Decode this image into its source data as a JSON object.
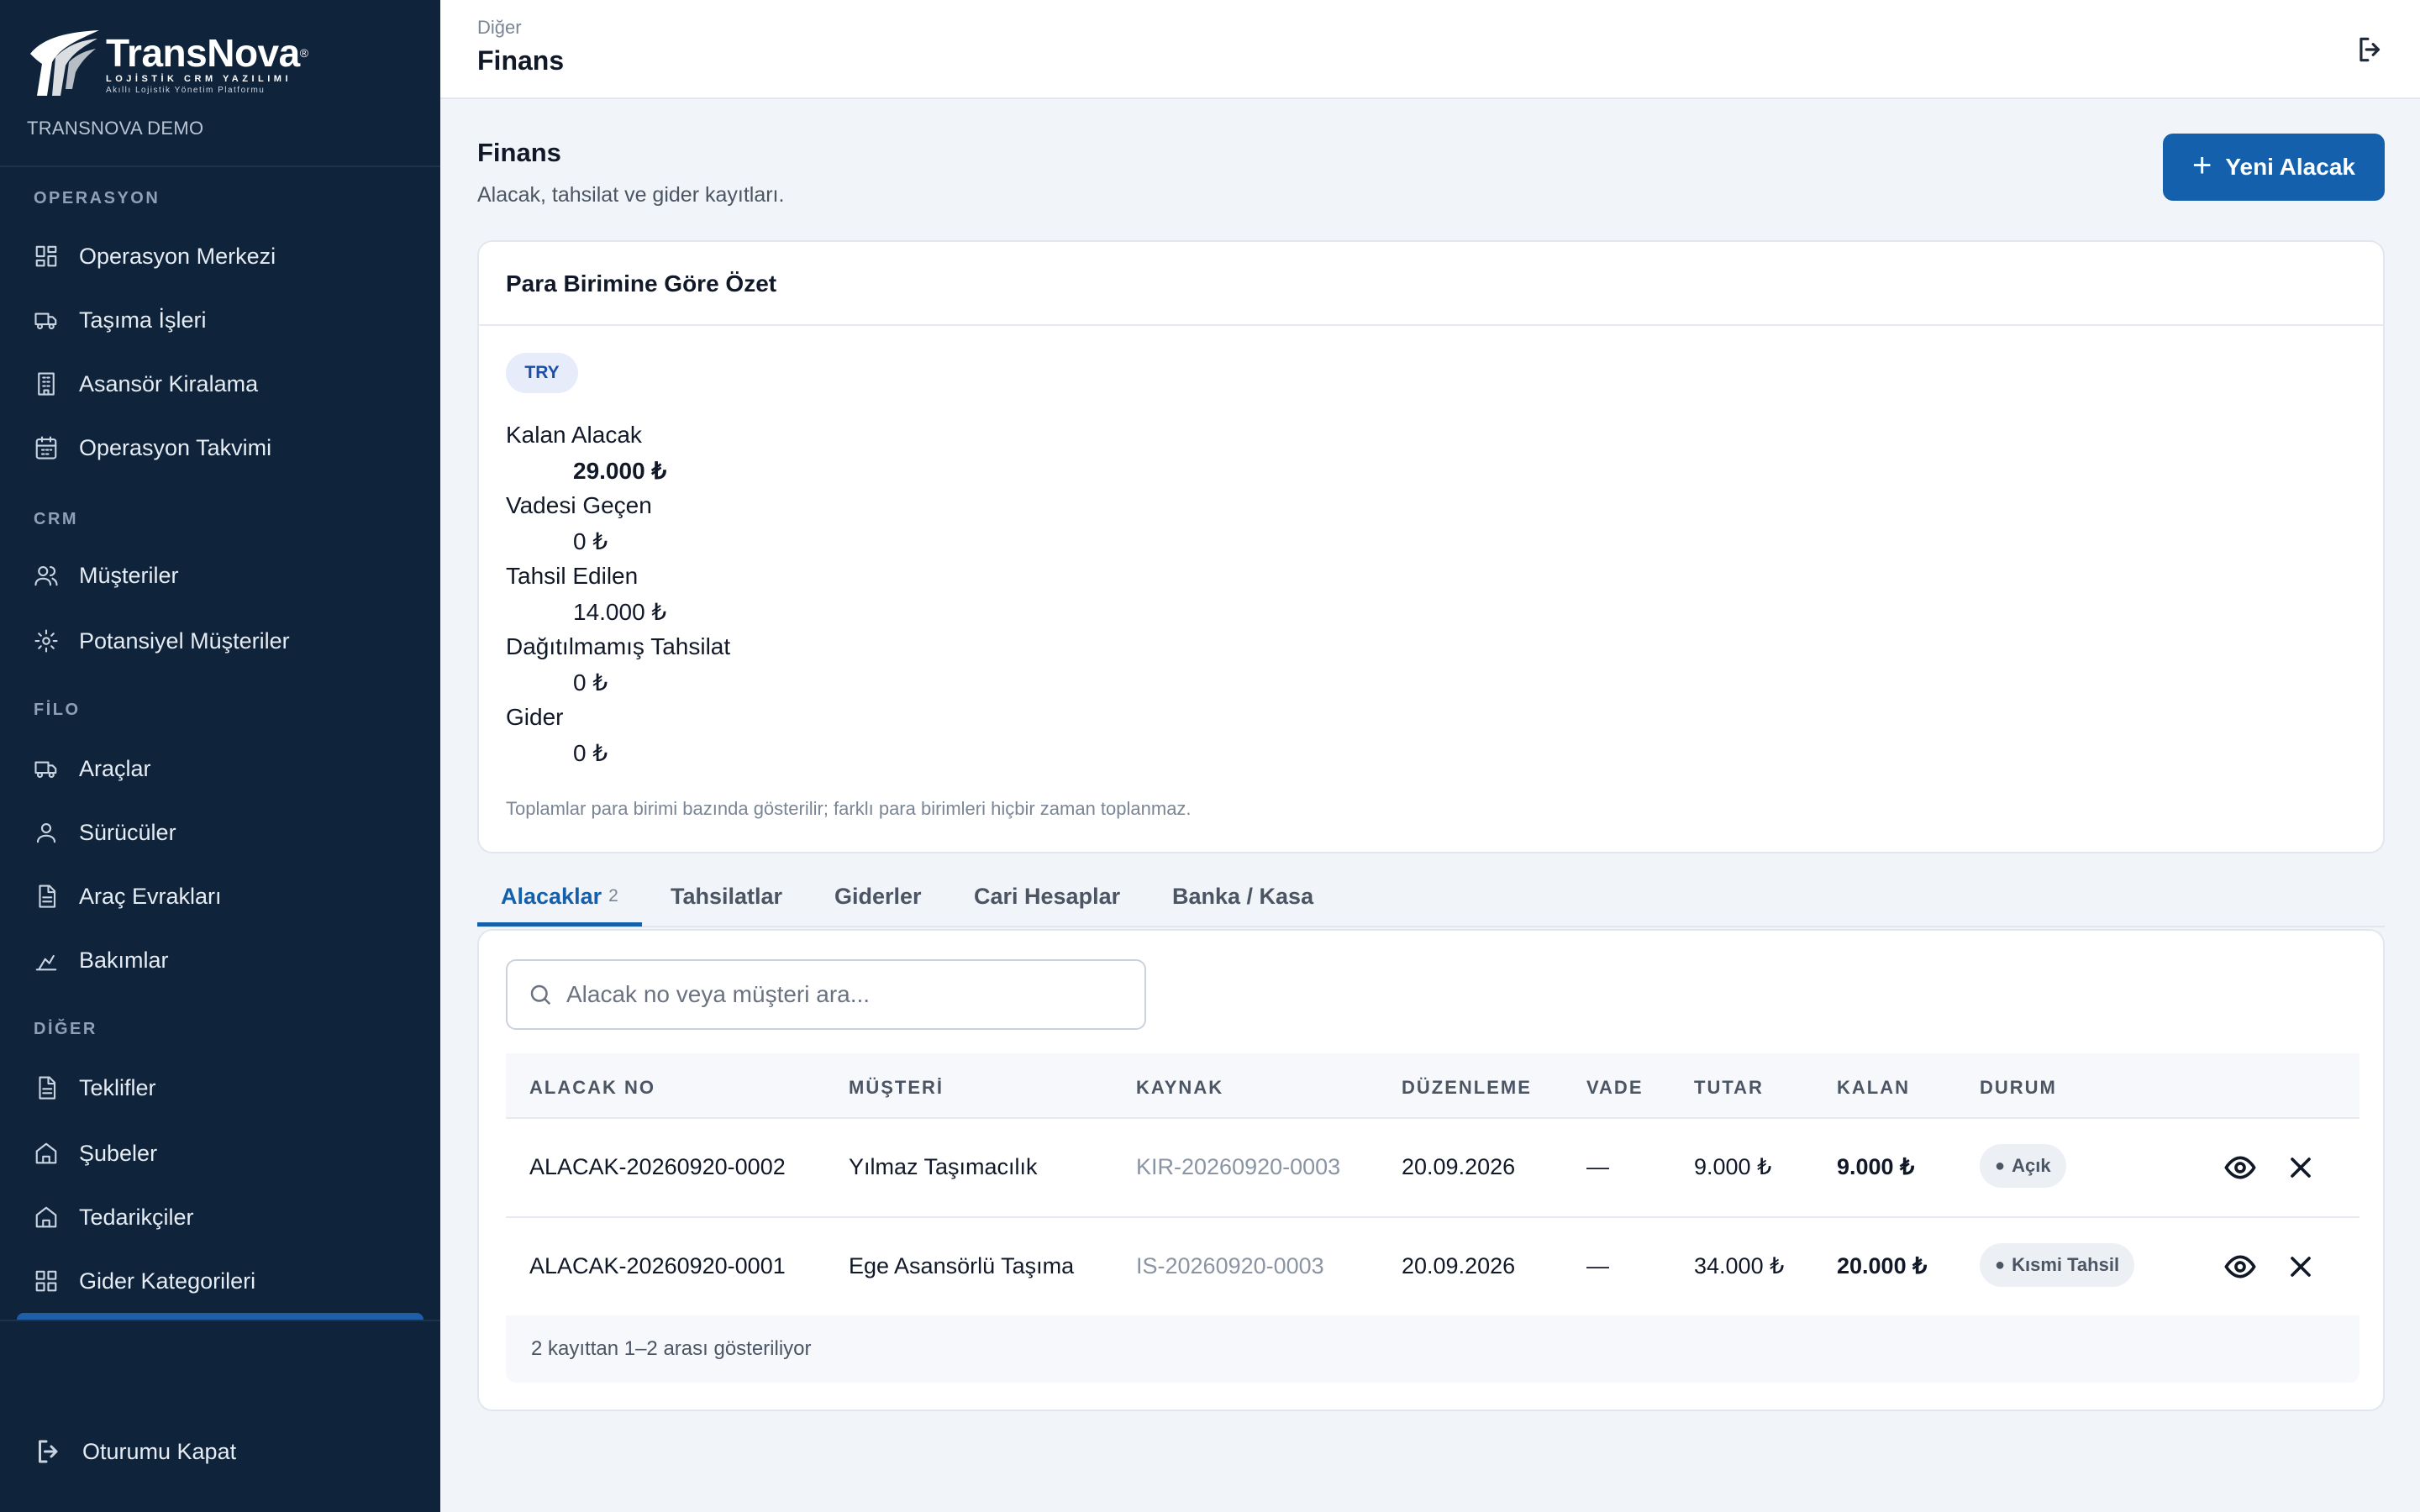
{
  "brand": {
    "name": "TransNova",
    "tagline": "LOJİSTİK CRM YAZILIMI",
    "subtagline": "Akıllı Lojistik Yönetim Platformu",
    "tenant": "TRANSNOVA DEMO"
  },
  "sidebar": {
    "sections": {
      "operasyon": "OPERASYON",
      "crm": "CRM",
      "filo": "FİLO",
      "diger": "DİĞER"
    },
    "items": {
      "operasyon_merkezi": "Operasyon Merkezi",
      "tasima_isleri": "Taşıma İşleri",
      "asansor_kiralama": "Asansör Kiralama",
      "operasyon_takvimi": "Operasyon Takvimi",
      "musteriler": "Müşteriler",
      "potansiyel_musteriler": "Potansiyel Müşteriler",
      "araclar": "Araçlar",
      "suruculer": "Sürücüler",
      "arac_evraklari": "Araç Evrakları",
      "bakimlar": "Bakımlar",
      "teklifler": "Teklifler",
      "subeler": "Şubeler",
      "tedarikciler": "Tedarikçiler",
      "gider_kategorileri": "Gider Kategorileri"
    },
    "logout": "Oturumu Kapat"
  },
  "header": {
    "breadcrumb": "Diğer",
    "title": "Finans"
  },
  "main": {
    "title": "Finans",
    "subtitle": "Alacak, tahsilat ve gider kayıtları.",
    "new_button": "Yeni Alacak"
  },
  "summary": {
    "title": "Para Birimine Göre Özet",
    "currency": "TRY",
    "stats": [
      {
        "label": "Kalan Alacak",
        "value": "29.000 ₺"
      },
      {
        "label": "Vadesi Geçen",
        "value": "0 ₺"
      },
      {
        "label": "Tahsil Edilen",
        "value": "14.000 ₺"
      },
      {
        "label": "Dağıtılmamış Tahsilat",
        "value": "0 ₺"
      },
      {
        "label": "Gider",
        "value": "0 ₺"
      }
    ],
    "note": "Toplamlar para birimi bazında gösterilir; farklı para birimleri hiçbir zaman toplanmaz."
  },
  "tabs": [
    {
      "label": "Alacaklar",
      "count": "2"
    },
    {
      "label": "Tahsilatlar"
    },
    {
      "label": "Giderler"
    },
    {
      "label": "Cari Hesaplar"
    },
    {
      "label": "Banka / Kasa"
    }
  ],
  "table": {
    "search_placeholder": "Alacak no veya müşteri ara...",
    "columns": [
      "ALACAK NO",
      "MÜŞTERİ",
      "KAYNAK",
      "DÜZENLEME",
      "VADE",
      "TUTAR",
      "KALAN",
      "DURUM"
    ],
    "rows": [
      {
        "no": "ALACAK-20260920-0002",
        "musteri": "Yılmaz Taşımacılık",
        "kaynak": "KIR-20260920-0003",
        "duzenleme": "20.09.2026",
        "vade": "—",
        "tutar": "9.000 ₺",
        "kalan": "9.000 ₺",
        "durum": "Açık"
      },
      {
        "no": "ALACAK-20260920-0001",
        "musteri": "Ege Asansörlü Taşıma",
        "kaynak": "IS-20260920-0003",
        "duzenleme": "20.09.2026",
        "vade": "—",
        "tutar": "34.000 ₺",
        "kalan": "20.000 ₺",
        "durum": "Kısmi Tahsil"
      }
    ],
    "footer": "2 kayıttan 1–2 arası gösteriliyor"
  },
  "colors": {
    "sidebar_bg": "#0f233a",
    "accent": "#1460ad",
    "badge_bg": "#e6ecfa"
  }
}
